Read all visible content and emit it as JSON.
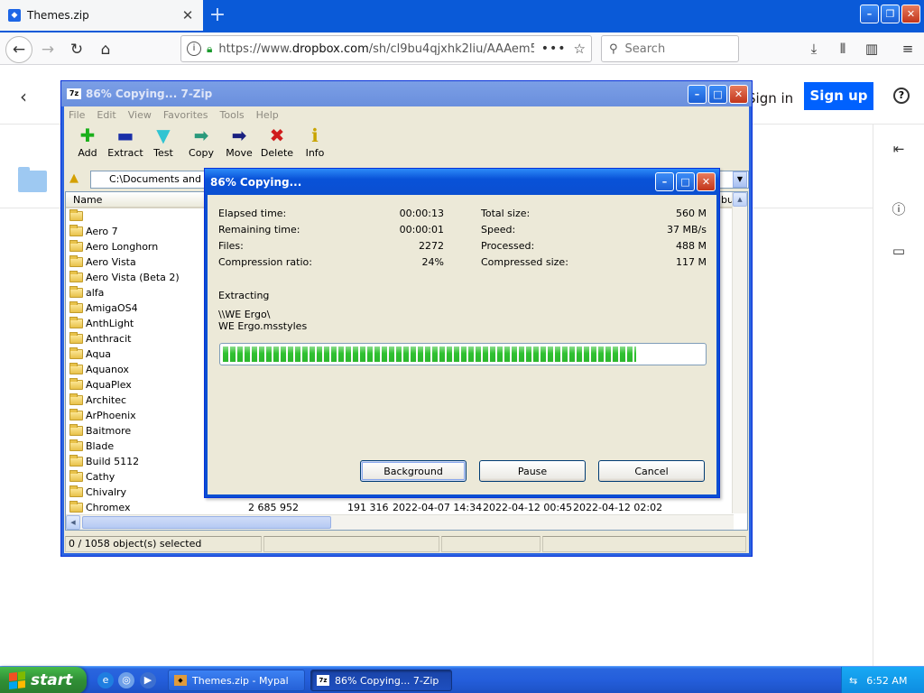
{
  "browser": {
    "tab_title": "Themes.zip",
    "tab_close": "✕",
    "new_tab": "+",
    "url_prefix": "https://www.",
    "url_domain": "dropbox.com",
    "url_path": "/sh/cl9bu4qjxhk2liu/AAAem5",
    "search_placeholder": "Search"
  },
  "dropbox": {
    "sign_in": "Sign in",
    "sign_up": "Sign up",
    "help": "?"
  },
  "zip": {
    "title": "86% Copying... 7-Zip",
    "menu": [
      "File",
      "Edit",
      "View",
      "Favorites",
      "Tools",
      "Help"
    ],
    "toolbar": [
      {
        "label": "Add",
        "icon": "plus-icon",
        "glyph": "✚",
        "color": "#1bb01b"
      },
      {
        "label": "Extract",
        "icon": "minus-icon",
        "glyph": "▬",
        "color": "#1a2fa8"
      },
      {
        "label": "Test",
        "icon": "check-icon",
        "glyph": "▼",
        "color": "#31c4d2"
      },
      {
        "label": "Copy",
        "icon": "copy-arrow-icon",
        "glyph": "➡",
        "color": "#2a9a7c"
      },
      {
        "label": "Move",
        "icon": "move-arrow-icon",
        "glyph": "➡",
        "color": "#1a2080"
      },
      {
        "label": "Delete",
        "icon": "delete-x-icon",
        "glyph": "✖",
        "color": "#d01c1c"
      },
      {
        "label": "Info",
        "icon": "info-icon",
        "glyph": "ℹ",
        "color": "#c9a400"
      }
    ],
    "path": "C:\\Documents and Se",
    "col_name": "Name",
    "col_last_partial": "bu",
    "files": [
      "",
      "Aero 7",
      "Aero Longhorn",
      "Aero Vista",
      "Aero Vista (Beta 2)",
      "alfa",
      "AmigaOS4",
      "AnthLight",
      "Anthracit",
      "Aqua",
      "Aquanox",
      "AquaPlex",
      "Architec",
      "ArPhoenix",
      "Baitmore",
      "Blade",
      "Build 5112",
      "Cathy",
      "Chivalry",
      "Chromex"
    ],
    "last_row": {
      "size": "2 685 952",
      "packed": "191 316",
      "modified": "2022-04-07 14:34",
      "created": "2022-04-12 00:45",
      "accessed": "2022-04-12 02:02"
    },
    "status": "0 / 1058 object(s) selected"
  },
  "dialog": {
    "title": "86% Copying...",
    "left": [
      {
        "label": "Elapsed time:",
        "value": "00:00:13"
      },
      {
        "label": "Remaining time:",
        "value": "00:00:01"
      },
      {
        "label": "Files:",
        "value": "2272"
      },
      {
        "label": "Compression ratio:",
        "value": "24%"
      }
    ],
    "right": [
      {
        "label": "Total size:",
        "value": "560 M"
      },
      {
        "label": "Speed:",
        "value": "37 MB/s"
      },
      {
        "label": "Processed:",
        "value": "488 M"
      },
      {
        "label": "Compressed size:",
        "value": "117 M"
      }
    ],
    "action": "Extracting",
    "path_line1": "\\\\WE Ergo\\",
    "path_line2": "WE Ergo.msstyles",
    "progress_percent": 86,
    "buttons": {
      "background": "Background",
      "pause": "Pause",
      "cancel": "Cancel"
    }
  },
  "taskbar": {
    "start": "start",
    "items": [
      {
        "label": "Themes.zip - Mypal",
        "active": false
      },
      {
        "label": "86% Copying... 7-Zip",
        "active": true
      }
    ],
    "clock": "6:52 AM"
  },
  "colors": {
    "xp_blue": "#0a4fd1",
    "dropbox_blue": "#0061fe",
    "progress_green": "#2fc130",
    "start_green": "#308f36"
  }
}
